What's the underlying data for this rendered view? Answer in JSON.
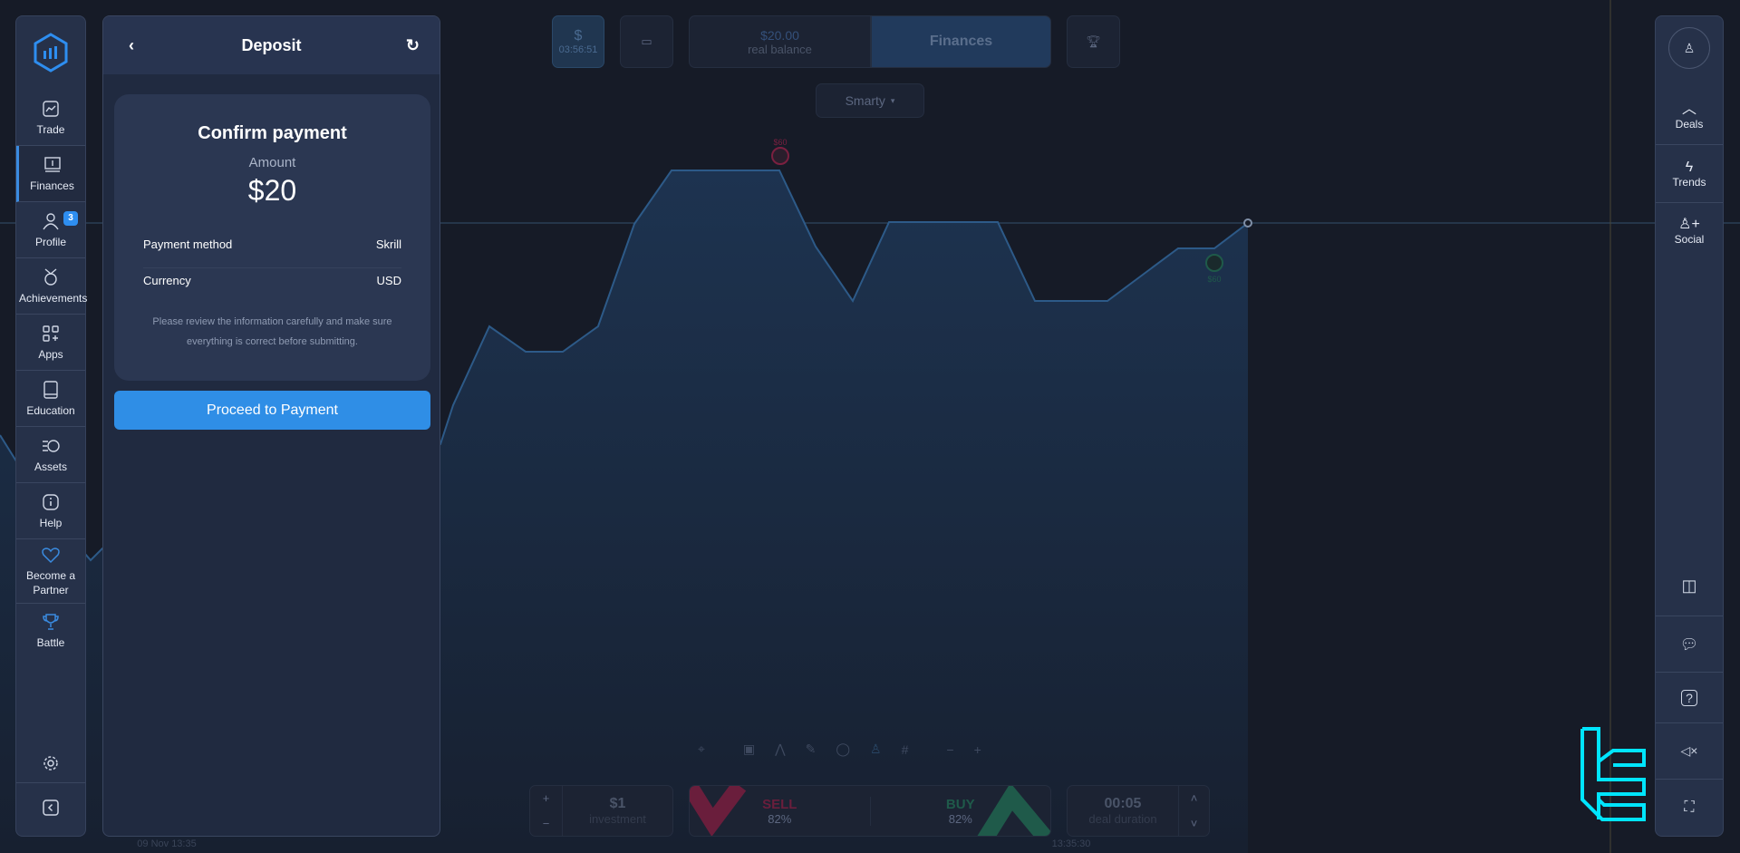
{
  "sidebar": {
    "items": [
      {
        "label": "Trade",
        "icon": "chart-line-icon"
      },
      {
        "label": "Finances",
        "icon": "finances-icon",
        "active": true
      },
      {
        "label": "Profile",
        "icon": "user-icon",
        "badge": "3"
      },
      {
        "label": "Achievements",
        "icon": "medal-icon"
      },
      {
        "label": "Apps",
        "icon": "apps-icon"
      },
      {
        "label": "Education",
        "icon": "book-icon"
      },
      {
        "label": "Assets",
        "icon": "assets-clock-icon"
      },
      {
        "label": "Help",
        "icon": "info-icon"
      },
      {
        "label": "Become a Partner",
        "icon": "heart-icon"
      },
      {
        "label": "Battle",
        "icon": "trophy-icon"
      }
    ]
  },
  "deposit": {
    "title": "Deposit",
    "card_title": "Confirm payment",
    "amount_label": "Amount",
    "amount": "$20",
    "rows": [
      {
        "label": "Payment method",
        "value": "Skrill"
      },
      {
        "label": "Currency",
        "value": "USD"
      }
    ],
    "note": "Please review the information carefully and make sure everything is correct before submitting.",
    "proceed_label": "Proceed to Payment"
  },
  "topbar": {
    "timer": "03:56:51",
    "balance": "$20.00",
    "balance_label": "real balance",
    "finances_label": "Finances",
    "asset": "Smarty"
  },
  "chart": {
    "marker_sell": "$60",
    "marker_buy": "$60",
    "date_label": "09 Nov 13:35",
    "time_label": "13:35:30"
  },
  "trade": {
    "investment": "$1",
    "investment_label": "investment",
    "sell_label": "SELL",
    "sell_pct": "82%",
    "buy_label": "BUY",
    "buy_pct": "82%",
    "duration": "00:05",
    "duration_label": "deal duration"
  },
  "right": {
    "items": [
      {
        "label": "Deals"
      },
      {
        "label": "Trends"
      },
      {
        "label": "Social"
      }
    ]
  },
  "colors": {
    "accent": "#2f8ee6",
    "sell": "#7a2040",
    "buy": "#1f5a4a",
    "watermark": "#00e5ff"
  }
}
